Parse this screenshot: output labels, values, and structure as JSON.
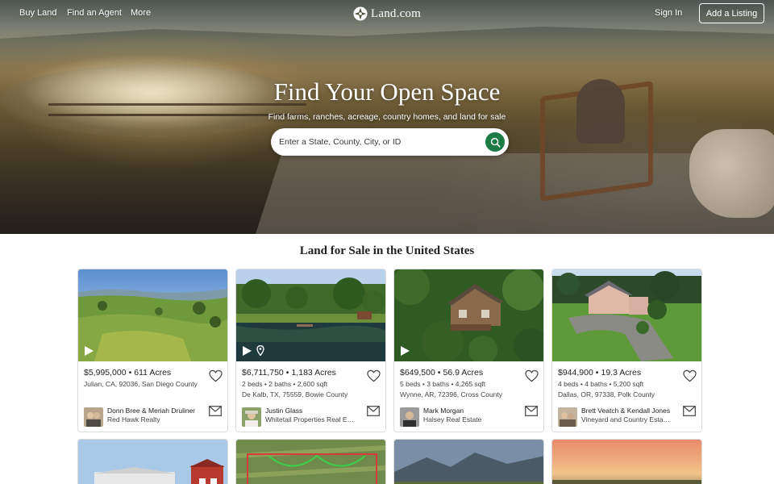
{
  "nav": {
    "buy_land": "Buy Land",
    "find_agent": "Find an Agent",
    "more": "More",
    "logo_text": "Land.com",
    "sign_in": "Sign In",
    "add_listing": "Add a Listing"
  },
  "hero": {
    "title": "Find Your Open Space",
    "subtitle": "Find farms, ranches, acreage, country homes, and land for sale",
    "search_placeholder": "Enter a State, County, City, or ID"
  },
  "section": {
    "title": "Land for Sale in the United States"
  },
  "colors": {
    "accent_green": "#1c7a45",
    "border": "#dcdcdc",
    "text": "#222222"
  },
  "listings": [
    {
      "price": "$5,995,000",
      "acres": "611 Acres",
      "details": "",
      "address": "Julian, CA, 92036, San Diego County",
      "agent_name": "Donn Bree & Meriah Druliner",
      "agent_firm": "Red Hawk Realty",
      "media": [
        "play-icon"
      ]
    },
    {
      "price": "$6,711,750",
      "acres": "1,183 Acres",
      "details": "2 beds • 2 baths • 2,600 sqft",
      "address": "De Kalb, TX, 75559, Bowie County",
      "agent_name": "Justin Glass",
      "agent_firm": "Whitetail Properties Real Est...",
      "media": [
        "play-icon",
        "map-pin-icon"
      ]
    },
    {
      "price": "$649,500",
      "acres": "56.9 Acres",
      "details": "5 beds • 3 baths • 4,265 sqft",
      "address": "Wynne, AR, 72396, Cross County",
      "agent_name": "Mark Morgan",
      "agent_firm": "Halsey Real Estate",
      "media": [
        "play-icon"
      ]
    },
    {
      "price": "$944,900",
      "acres": "19.3 Acres",
      "details": "4 beds • 4 baths • 5,200 sqft",
      "address": "Dallas, OR, 97338, Polk County",
      "agent_name": "Brett Veatch & Kendall Jones",
      "agent_firm": "Vineyard and Country Estate...",
      "media": []
    }
  ]
}
